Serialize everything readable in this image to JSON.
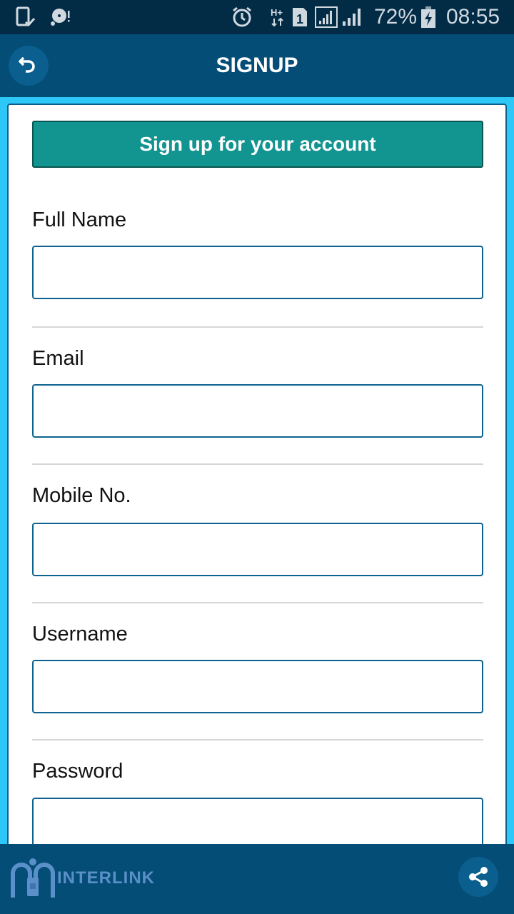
{
  "status_bar": {
    "battery_percent": "72%",
    "time": "08:55",
    "network_type": "H+",
    "sim_slot": "1",
    "icons": [
      "device-check-icon",
      "disc-alert-icon",
      "alarm-icon",
      "hplus-data-icon",
      "sim-1-icon",
      "signal-sim1-icon",
      "signal-sim2-icon",
      "battery-charging-icon"
    ]
  },
  "app_bar": {
    "title": "SIGNUP",
    "back_icon": "undo-arrow-icon"
  },
  "form": {
    "banner": "Sign up for your account",
    "fields": [
      {
        "label": "Full Name",
        "value": "",
        "placeholder": ""
      },
      {
        "label": "Email",
        "value": "",
        "placeholder": ""
      },
      {
        "label": "Mobile No.",
        "value": "",
        "placeholder": ""
      },
      {
        "label": "Username",
        "value": "",
        "placeholder": ""
      },
      {
        "label": "Password",
        "value": "",
        "placeholder": ""
      }
    ]
  },
  "footer": {
    "logo_text": "INTERLINK",
    "share_icon": "share-icon"
  },
  "colors": {
    "status_bar": "#022b46",
    "app_bar": "#034d76",
    "page_background": "#2ec8f8",
    "banner": "#129490",
    "input_border": "#0d6290"
  }
}
